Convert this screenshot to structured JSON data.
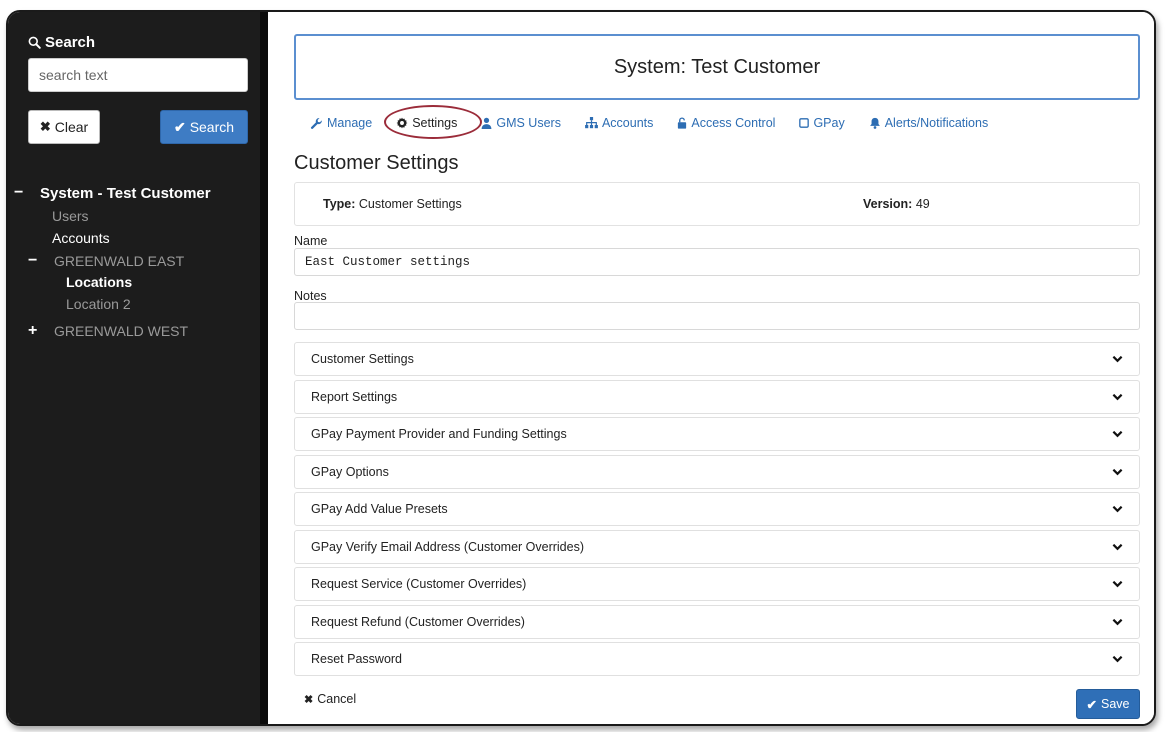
{
  "sidebar": {
    "search_heading": "Search",
    "search_placeholder": "search text",
    "clear_label": "Clear",
    "search_button_label": "Search",
    "tree": {
      "system": "System - Test Customer",
      "users": "Users",
      "accounts": "Accounts",
      "east": "GREENWALD EAST",
      "locations": "Locations",
      "location2": "Location 2",
      "west": "GREENWALD WEST"
    }
  },
  "header": {
    "title": "System: Test Customer"
  },
  "tabs": [
    {
      "label": "Manage",
      "icon": "wrench-icon"
    },
    {
      "label": "Settings",
      "icon": "gear-icon"
    },
    {
      "label": "GMS Users",
      "icon": "user-icon"
    },
    {
      "label": "Accounts",
      "icon": "sitemap-icon"
    },
    {
      "label": "Access Control",
      "icon": "lock-icon"
    },
    {
      "label": "GPay",
      "icon": "square-icon"
    },
    {
      "label": "Alerts/Notifications",
      "icon": "bell-icon"
    }
  ],
  "main": {
    "heading": "Customer Settings",
    "type_label": "Type:",
    "type_value": "Customer Settings",
    "version_label": "Version:",
    "version_value": "49",
    "name_label": "Name",
    "name_value": "East Customer settings",
    "notes_label": "Notes",
    "notes_value": ""
  },
  "accordion": [
    "Customer Settings",
    "Report Settings",
    "GPay Payment Provider and Funding Settings",
    "GPay Options",
    "GPay Add Value Presets",
    "GPay Verify Email Address (Customer Overrides)",
    "Request Service (Customer Overrides)",
    "Request Refund (Customer Overrides)",
    "Reset Password"
  ],
  "footer": {
    "cancel_label": "Cancel",
    "save_label": "Save"
  },
  "colors": {
    "sidebar_bg": "#1c1c1c",
    "accent": "#3e7cc4",
    "highlight_circle": "#9b2c3a"
  }
}
